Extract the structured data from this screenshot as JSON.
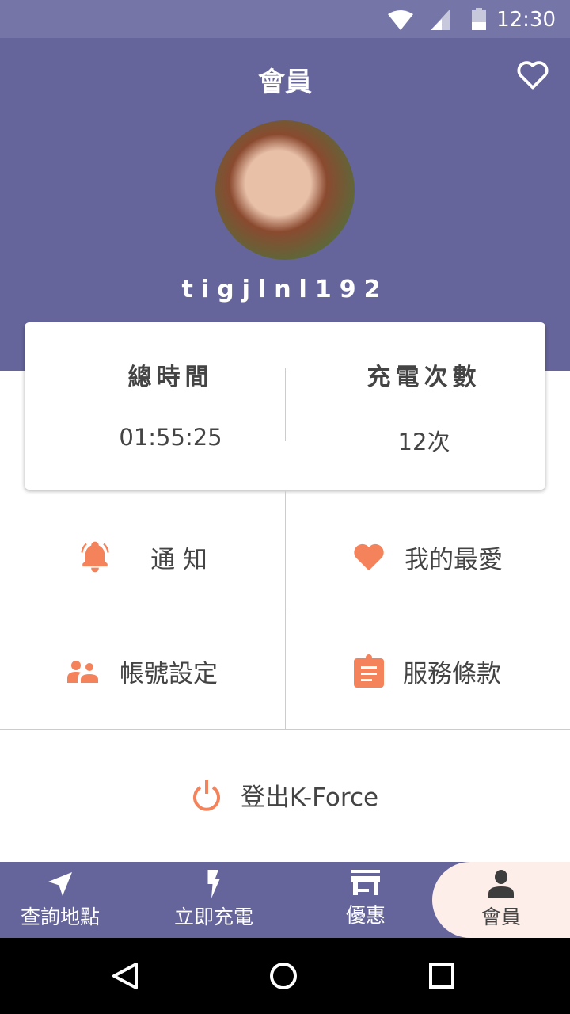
{
  "status": {
    "time": "12:30"
  },
  "header": {
    "title": "會員",
    "username": "tigjlnl192"
  },
  "stats": [
    {
      "label": "總時間",
      "value": "01:55:25"
    },
    {
      "label": "充電次數",
      "value": "12次"
    }
  ],
  "menu": [
    {
      "label": "通 知",
      "icon": "bell-icon"
    },
    {
      "label": "我的最愛",
      "icon": "heart-icon"
    },
    {
      "label": "帳號設定",
      "icon": "people-icon"
    },
    {
      "label": "服務條款",
      "icon": "clipboard-icon"
    }
  ],
  "logout": {
    "label": "登出K-Force"
  },
  "nav": [
    {
      "label": "查詢地點"
    },
    {
      "label": "立即充電"
    },
    {
      "label": "優惠"
    },
    {
      "label": "會員"
    }
  ],
  "colors": {
    "primary": "#65659b",
    "accent": "#f4825a",
    "active_tab": "#fdeeea"
  }
}
